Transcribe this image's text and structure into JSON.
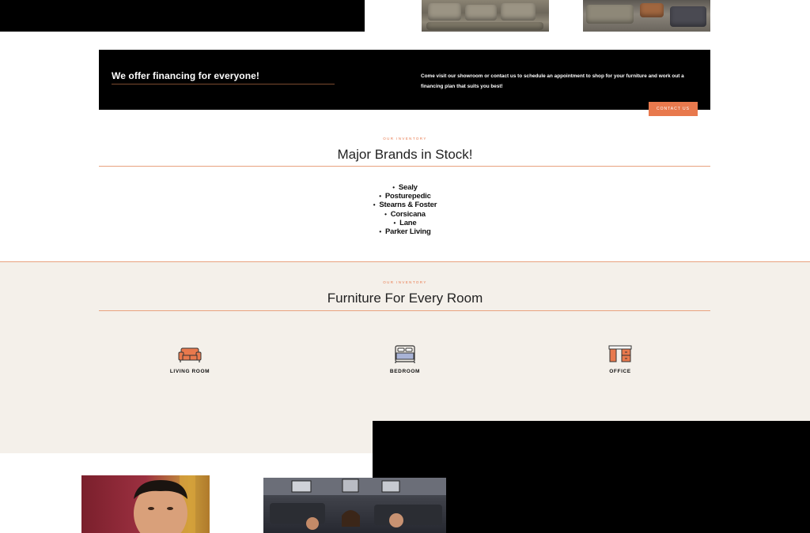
{
  "financing": {
    "title": "We offer financing for everyone!",
    "text": "Come visit our showroom or contact us to schedule an appointment to shop for your furniture and work out a financing plan that suits you best!",
    "button": "CONTACT US"
  },
  "brands_section": {
    "eyebrow": "OUR INVENTORY",
    "title": "Major Brands in Stock!",
    "items": [
      "Sealy",
      "Posturepedic",
      "Stearns & Foster",
      "Corsicana",
      "Lane",
      "Parker Living"
    ]
  },
  "rooms_section": {
    "eyebrow": "OUR INVENTORY",
    "title": "Furniture For Every Room",
    "rooms": [
      {
        "label": "LIVING ROOM",
        "icon": "sofa-icon"
      },
      {
        "label": "BEDROOM",
        "icon": "bed-icon"
      },
      {
        "label": "OFFICE",
        "icon": "desk-icon"
      }
    ]
  },
  "colors": {
    "accent": "#e8794d",
    "band": "#000000",
    "section_bg": "#f4f0ea"
  }
}
